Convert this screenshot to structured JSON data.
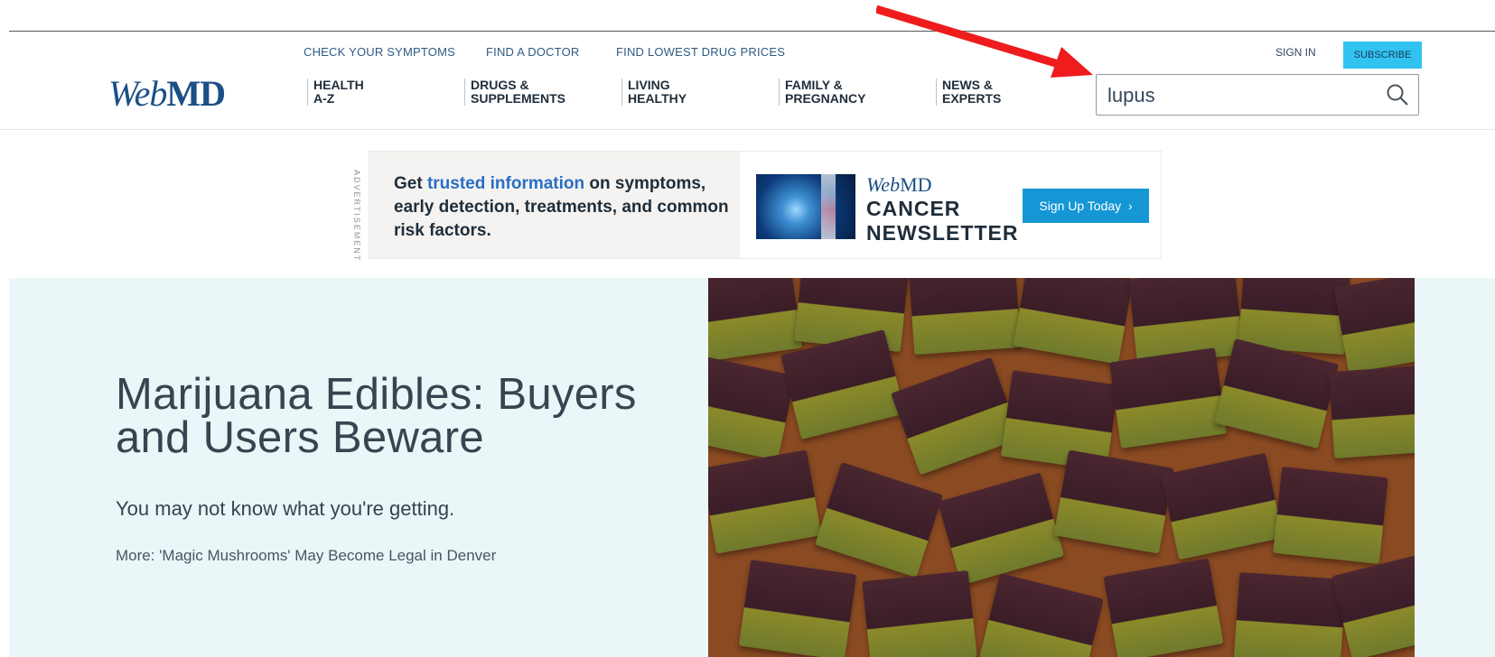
{
  "annotation": {
    "arrow_color": "#ee1c1c"
  },
  "header": {
    "logo": {
      "web": "Web",
      "md": "MD"
    },
    "utility_links": [
      "CHECK YOUR SYMPTOMS",
      "FIND A DOCTOR",
      "FIND LOWEST DRUG PRICES"
    ],
    "nav": [
      {
        "line1": "HEALTH",
        "line2": "A-Z"
      },
      {
        "line1": "DRUGS &",
        "line2": "SUPPLEMENTS"
      },
      {
        "line1": "LIVING",
        "line2": "HEALTHY"
      },
      {
        "line1": "FAMILY &",
        "line2": "PREGNANCY"
      },
      {
        "line1": "NEWS &",
        "line2": "EXPERTS"
      }
    ],
    "sign_in": "SIGN IN",
    "subscribe": "SUBSCRIBE",
    "search": {
      "value": "lupus",
      "icon": "search-icon"
    }
  },
  "ad": {
    "label": "ADVERTISEMENT",
    "text_pre": "Get ",
    "text_highlight": "trusted information",
    "text_post": " on symptoms, early detection, treatments, and common risk factors.",
    "brand_web": "Web",
    "brand_md": "MD",
    "title_line1": "CANCER",
    "title_line2": "NEWSLETTER",
    "cta": "Sign Up Today",
    "cta_icon": "chevron-right-icon"
  },
  "hero": {
    "title": "Marijuana Edibles: Buyers and Users Beware",
    "subtitle": "You may not know what you're getting.",
    "more": "More: 'Magic Mushrooms' May Become Legal in Denver",
    "image_alt": "brownies-image"
  },
  "colors": {
    "brand": "#1b4f86",
    "accent": "#32c2f0",
    "hero_bg": "#eaf6f8",
    "cta": "#1597d5"
  }
}
